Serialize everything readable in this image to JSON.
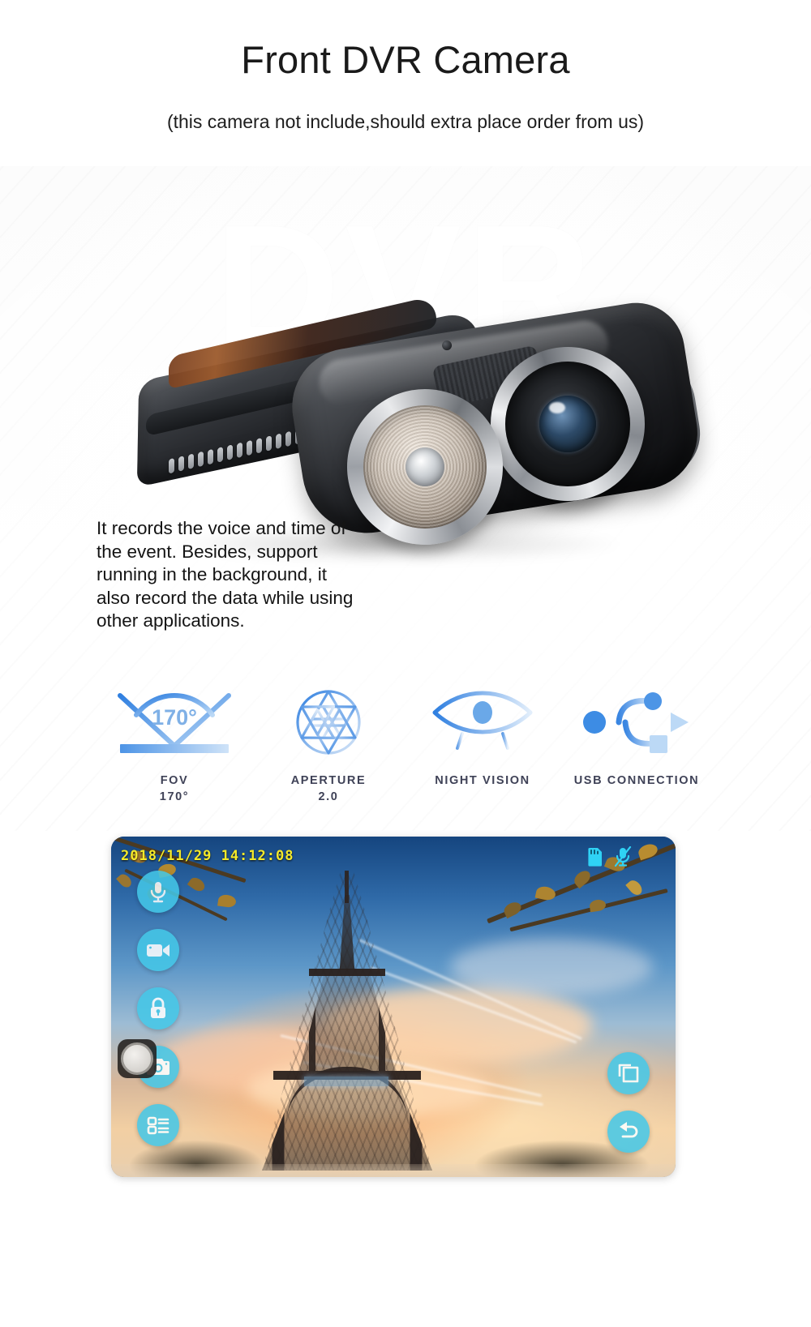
{
  "header": {
    "title": "Front DVR Camera",
    "subtitle": "(this camera not include,should extra place order from us)"
  },
  "watermark": "DVR",
  "description": "It records the voice and time of the event. Besides, support running in the background, it also record the data while using other applications.",
  "features": [
    {
      "icon": "fov-angle-icon",
      "value_in_icon": "170°",
      "label": "FOV",
      "sub": "170°"
    },
    {
      "icon": "aperture-icon",
      "value_in_icon": "",
      "label": "APERTURE",
      "sub": "2.0"
    },
    {
      "icon": "night-vision-eye-icon",
      "value_in_icon": "",
      "label": "NIGHT VISION",
      "sub": ""
    },
    {
      "icon": "usb-icon",
      "value_in_icon": "",
      "label": "USB CONNECTION",
      "sub": ""
    }
  ],
  "app_screenshot": {
    "timestamp": "2018/11/29  14:12:08",
    "status_icons": [
      "sd-card-icon",
      "microphone-muted-icon"
    ],
    "left_buttons": [
      "microphone-icon",
      "video-camera-icon",
      "lock-icon",
      "camera-icon",
      "list-icon"
    ],
    "right_buttons": [
      "copy-layers-icon",
      "back-arrow-icon"
    ],
    "home_key": "home-button-icon"
  },
  "colors": {
    "accent_blue": "#5b9bea",
    "label_slate": "#3f4257",
    "app_button": "#44c8e8",
    "timestamp_yellow": "#f5ea2a",
    "status_icon": "#2fd2f5"
  }
}
